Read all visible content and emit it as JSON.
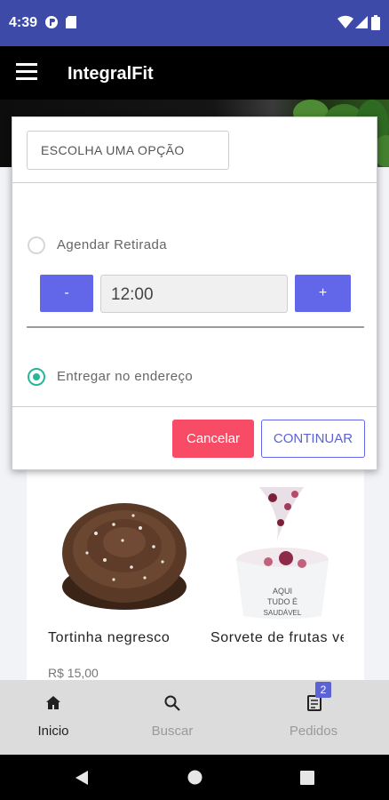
{
  "status_bar": {
    "time": "4:39",
    "icons": [
      "app-notification-icon",
      "sd-card-icon",
      "wifi-icon",
      "signal-icon",
      "battery-icon"
    ]
  },
  "app_bar": {
    "title": "IntegralFit",
    "menu_icon": "hamburger-menu-icon"
  },
  "modal": {
    "option_label": "ESCOLHA UMA OPÇÃO",
    "options": [
      {
        "label": "Agendar Retirada",
        "selected": false
      },
      {
        "label": "Entregar no endereço",
        "selected": true
      }
    ],
    "time_picker": {
      "minus_label": "-",
      "value": "12:00",
      "plus_label": "+"
    },
    "cancel_label": "Cancelar",
    "continue_label": "CONTINUAR"
  },
  "products": [
    {
      "name": "Tortinha negresco",
      "price": "R$ 15,00"
    },
    {
      "name": "Sorvete de frutas vermelhas vegano",
      "price": ""
    }
  ],
  "bottom_nav": {
    "items": [
      {
        "label": "Inicio",
        "icon": "home-icon",
        "active": true
      },
      {
        "label": "Buscar",
        "icon": "search-icon",
        "active": false
      },
      {
        "label": "Pedidos",
        "icon": "orders-icon",
        "active": false,
        "badge": "2"
      }
    ]
  },
  "colors": {
    "status_bar": "#3d4aa8",
    "accent": "#6167e8",
    "cancel": "#f74b66",
    "radio_selected": "#26b69a"
  }
}
